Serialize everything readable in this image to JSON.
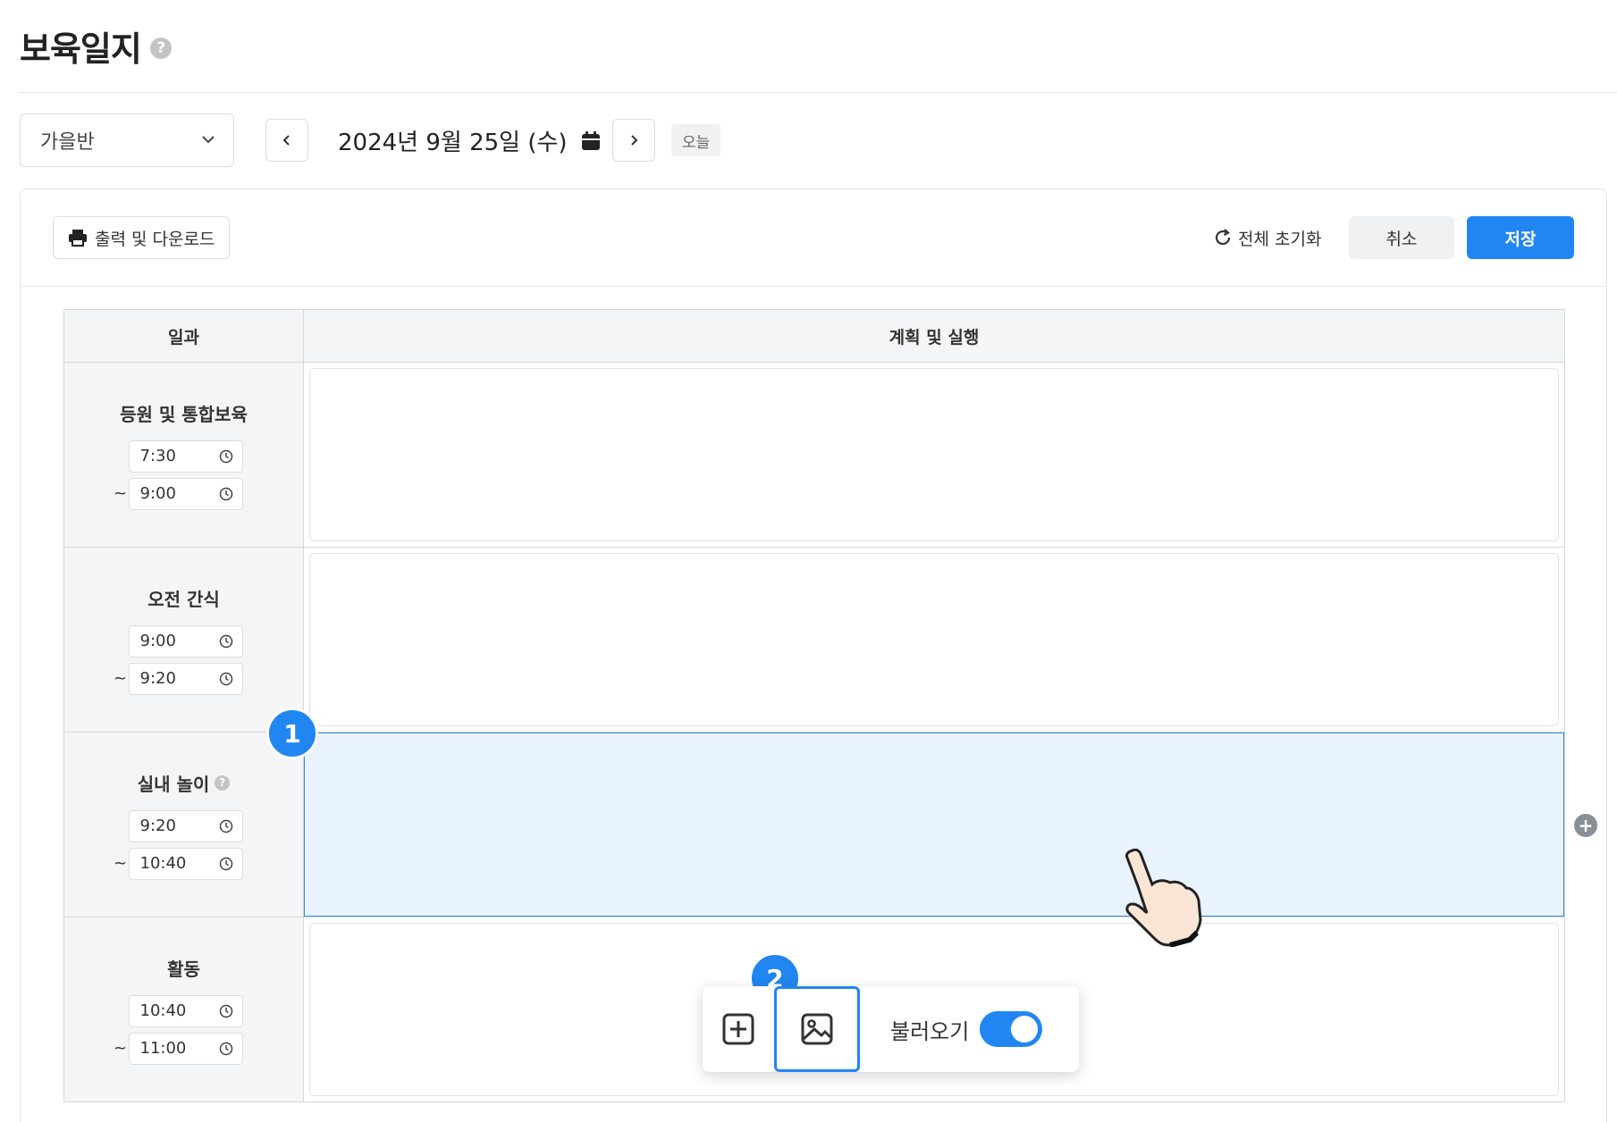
{
  "header": {
    "title": "보육일지",
    "help": "?"
  },
  "controls": {
    "class_select": "가을반",
    "date": "2024년 9월 25일 (수)",
    "today": "오늘"
  },
  "toolbar": {
    "print_label": "출력 및 다운로드",
    "reset_label": "전체 초기화",
    "cancel_label": "취소",
    "save_label": "저장"
  },
  "table": {
    "headers": [
      "일과",
      "계획 및 실행"
    ],
    "rows": [
      {
        "title": "등원 및 통합보육",
        "start": "7:30",
        "end": "9:00",
        "has_help": false
      },
      {
        "title": "오전 간식",
        "start": "9:00",
        "end": "9:20",
        "has_help": false
      },
      {
        "title": "실내 놀이",
        "start": "9:20",
        "end": "10:40",
        "has_help": true,
        "selected": true
      },
      {
        "title": "활동",
        "start": "10:40",
        "end": "11:00",
        "has_help": false
      }
    ]
  },
  "floating_toolbar": {
    "load_label": "불러오기",
    "load_enabled": true
  },
  "steps": {
    "step1": "1",
    "step2": "2"
  },
  "colors": {
    "accent": "#2186f2",
    "selected_bg": "#e9f3fd"
  }
}
